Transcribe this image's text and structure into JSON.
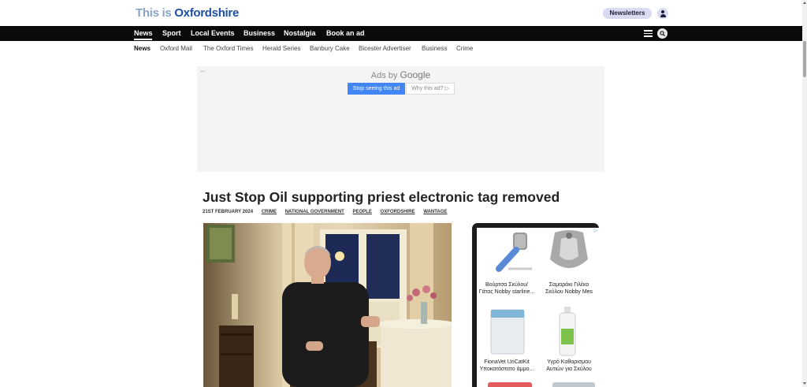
{
  "header": {
    "logo_part1": "This is ",
    "logo_part2": "Oxfordshire",
    "newsletters_label": "Newsletters"
  },
  "main_nav": {
    "items": [
      "News",
      "Sport",
      "Local Events",
      "Business",
      "Nostalgia",
      "Book an ad"
    ],
    "active": "News"
  },
  "sub_nav": {
    "items": [
      "News",
      "Oxford Mail",
      "The Oxford Times",
      "Herald Series",
      "Banbury Cake",
      "Bicester Advertiser",
      "Business",
      "Crime"
    ],
    "active": "News"
  },
  "ad": {
    "ads_by": "Ads by",
    "google": "Google",
    "stop_label": "Stop seeing this ad",
    "why_label": "Why this ad? ▷"
  },
  "article": {
    "headline": "Just Stop Oil supporting priest electronic tag removed",
    "date": "21ST FEBRUARY 2024",
    "tags": [
      "CRIME",
      "NATIONAL GOVERNMENT",
      "PEOPLE",
      "OXFORDSHIRE",
      "WANTAGE"
    ]
  },
  "side_ad": {
    "products": [
      {
        "line1": "Βούρτσα Σκύλου/",
        "line2": "Γάτας Nobby starline..."
      },
      {
        "line1": "Σαμαράκι Γιλέκο",
        "line2": "Σκύλου Nobby Mes"
      },
      {
        "line1": "FionaVet UriCatKit",
        "line2": "Υποκατάστατο άμμο..."
      },
      {
        "line1": "Υγρό Καθαρισμου",
        "line2": "Αυτιών για Σκύλου"
      }
    ]
  },
  "colors": {
    "brand_dark": "#1c4fa0",
    "brand_light": "#8aa4c8",
    "nav_bg": "#0b0b0b",
    "ad_button": "#4285f4"
  }
}
